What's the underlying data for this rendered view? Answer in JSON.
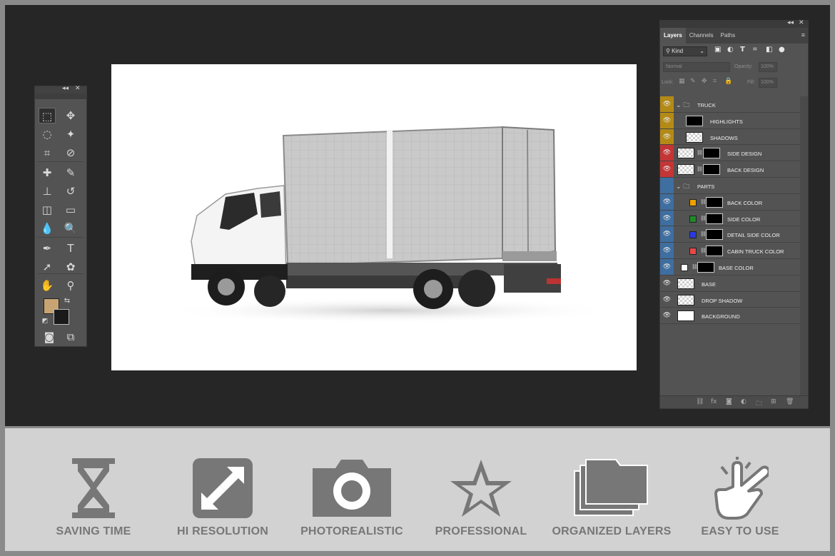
{
  "tools_panel": {
    "collapse_glyph": "◂◂",
    "close_glyph": "✕",
    "tools": [
      {
        "name": "marquee-tool",
        "glyph": "⬚"
      },
      {
        "name": "move-tool",
        "glyph": "✥"
      },
      {
        "name": "lasso-tool",
        "glyph": "◌"
      },
      {
        "name": "magic-wand-tool",
        "glyph": "✦"
      },
      {
        "name": "crop-tool",
        "glyph": "⌗"
      },
      {
        "name": "eyedropper-tool",
        "glyph": "⊘"
      },
      {
        "name": "healing-brush-tool",
        "glyph": "✚"
      },
      {
        "name": "brush-tool",
        "glyph": "✎"
      },
      {
        "name": "clone-stamp-tool",
        "glyph": "⊥"
      },
      {
        "name": "history-brush-tool",
        "glyph": "↺"
      },
      {
        "name": "eraser-tool",
        "glyph": "◫"
      },
      {
        "name": "gradient-tool",
        "glyph": "▭"
      },
      {
        "name": "blur-tool",
        "glyph": "💧"
      },
      {
        "name": "dodge-tool",
        "glyph": "🔍"
      },
      {
        "name": "pen-tool",
        "glyph": "✒"
      },
      {
        "name": "type-tool",
        "glyph": "T"
      },
      {
        "name": "path-selection-tool",
        "glyph": "➚"
      },
      {
        "name": "custom-shape-tool",
        "glyph": "✿"
      },
      {
        "name": "hand-tool",
        "glyph": "✋"
      },
      {
        "name": "zoom-tool",
        "glyph": "⚲"
      },
      {
        "name": "quick-mask-button",
        "glyph": "◙"
      },
      {
        "name": "screen-mode-button",
        "glyph": "⧉"
      }
    ],
    "foreground_color": "#c8a473",
    "background_color": "#1a1a1a"
  },
  "layers_panel": {
    "collapse_glyph": "◂◂",
    "close_glyph": "✕",
    "tabs": [
      "Layers",
      "Channels",
      "Paths"
    ],
    "menu_glyph": "≡",
    "filter": {
      "kind_label": "Kind"
    },
    "blend_mode": "Normal",
    "opacity_label": "Opacity:",
    "opacity_value": "100%",
    "lock_label": "Lock:",
    "fill_label": "Fill:",
    "fill_value": "100%",
    "layers": [
      {
        "name": "TRUCK",
        "type": "group",
        "tag": "yellow",
        "visible": true,
        "indent": 0
      },
      {
        "name": "HIGHLIGHTS",
        "type": "layer",
        "tag": "yellow",
        "visible": true,
        "indent": 1,
        "thumb": "black"
      },
      {
        "name": "SHADOWS",
        "type": "layer",
        "tag": "yellow",
        "visible": true,
        "indent": 1,
        "thumb": "check"
      },
      {
        "name": "SIDE DESIGN",
        "type": "smart",
        "tag": "red",
        "visible": true,
        "indent": 0
      },
      {
        "name": "BACK DESIGN",
        "type": "smart",
        "tag": "red",
        "visible": true,
        "indent": 0
      },
      {
        "name": "PARTS",
        "type": "group",
        "tag": "blue",
        "visible": false,
        "indent": 0
      },
      {
        "name": "BACK COLOR",
        "type": "fill",
        "tag": "blue",
        "visible": true,
        "indent": 1,
        "swatch": "#f0a000"
      },
      {
        "name": "SIDE COLOR",
        "type": "fill",
        "tag": "blue",
        "visible": true,
        "indent": 1,
        "swatch": "#1e8a2a"
      },
      {
        "name": "DETAIL SIDE COLOR",
        "type": "fill",
        "tag": "blue",
        "visible": true,
        "indent": 1,
        "swatch": "#2a38e0"
      },
      {
        "name": "CABIN TRUCK COLOR",
        "type": "fill",
        "tag": "blue",
        "visible": true,
        "indent": 1,
        "swatch": "#e84848"
      },
      {
        "name": "BASE COLOR",
        "type": "fill",
        "tag": "blue",
        "visible": true,
        "indent": 0,
        "swatch": "#ffffff"
      },
      {
        "name": "BASE",
        "type": "layer",
        "tag": "none",
        "visible": true,
        "indent": 0,
        "thumb": "check"
      },
      {
        "name": "DROP SHADOW",
        "type": "layer",
        "tag": "none",
        "visible": true,
        "indent": 0,
        "thumb": "check"
      },
      {
        "name": "BACKGROUND",
        "type": "layer",
        "tag": "none",
        "visible": true,
        "indent": 0,
        "thumb": "white"
      }
    ],
    "footer_icons": [
      "link-icon",
      "fx-icon",
      "mask-icon",
      "adjustment-icon",
      "folder-icon",
      "new-layer-icon",
      "trash-icon"
    ]
  },
  "features": [
    {
      "label": "SAVING TIME",
      "icon": "hourglass-icon"
    },
    {
      "label": "HI RESOLUTION",
      "icon": "expand-arrows-icon"
    },
    {
      "label": "PHOTOREALISTIC",
      "icon": "camera-icon"
    },
    {
      "label": "PROFESSIONAL",
      "icon": "star-icon"
    },
    {
      "label": "ORGANIZED LAYERS",
      "icon": "stacked-folders-icon"
    },
    {
      "label": "EASY TO USE",
      "icon": "tap-hand-icon"
    }
  ],
  "colors": {
    "workspace": "#262626",
    "panel": "#535353",
    "feature_icon": "#777777",
    "feature_bar": "#d2d2d2"
  }
}
